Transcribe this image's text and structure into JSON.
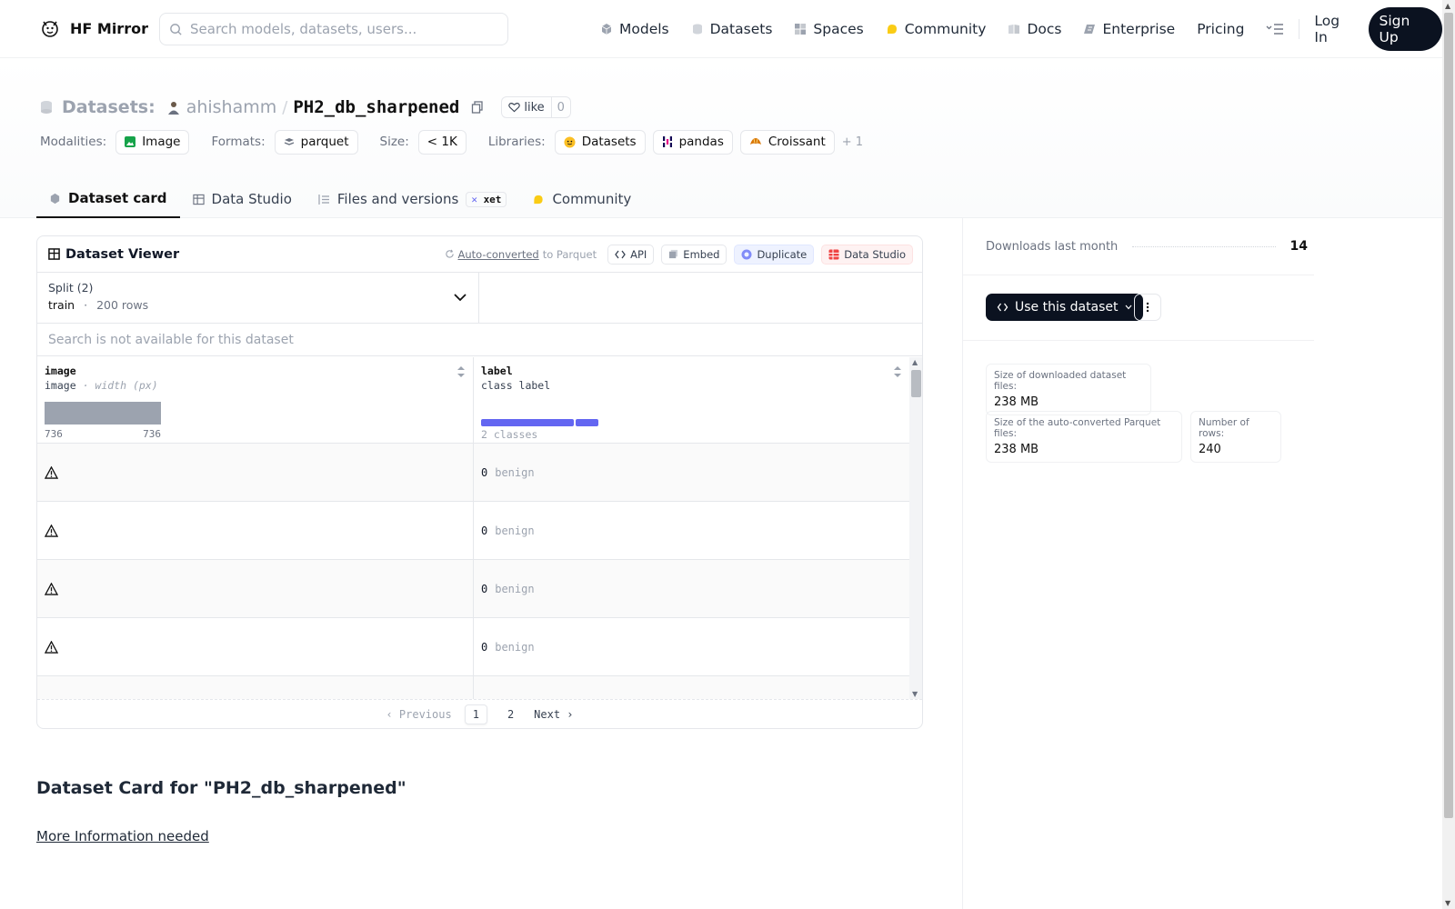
{
  "nav": {
    "brand": "HF Mirror",
    "search_placeholder": "Search models, datasets, users...",
    "items": [
      {
        "label": "Models",
        "icon": "models-icon",
        "color": "#9ca3af"
      },
      {
        "label": "Datasets",
        "icon": "datasets-icon",
        "color": "#d1d5db"
      },
      {
        "label": "Spaces",
        "icon": "spaces-icon",
        "color": "#9ca3af"
      },
      {
        "label": "Community",
        "icon": "community-icon",
        "color": "#facc15"
      },
      {
        "label": "Docs",
        "icon": "docs-icon",
        "color": "#d1d5db"
      },
      {
        "label": "Enterprise",
        "icon": "enterprise-icon",
        "color": "#9ca3af"
      },
      {
        "label": "Pricing",
        "icon": "",
        "color": ""
      }
    ],
    "login": "Log In",
    "signup": "Sign Up"
  },
  "header": {
    "section": "Datasets:",
    "owner": "ahishamm",
    "separator": "/",
    "repo": "PH2_db_sharpened",
    "like_label": "like",
    "like_count": "0",
    "meta": {
      "modalities_key": "Modalities:",
      "modalities": "Image",
      "formats_key": "Formats:",
      "formats": "parquet",
      "size_key": "Size:",
      "size": "< 1K",
      "libraries_key": "Libraries:",
      "libraries": [
        "Datasets",
        "pandas",
        "Croissant"
      ],
      "more": "+ 1"
    },
    "tabs": [
      "Dataset card",
      "Data Studio",
      "Files and versions",
      "Community"
    ],
    "xet_badge": "xet"
  },
  "viewer": {
    "title": "Dataset Viewer",
    "auto_converted": "Auto-converted",
    "to_parquet": "to Parquet",
    "buttons": {
      "api": "API",
      "embed": "Embed",
      "duplicate": "Duplicate",
      "studio": "Data Studio"
    },
    "split_label": "Split (2)",
    "split_value": "train",
    "split_dot": "·",
    "split_rows": "200 rows",
    "search_na": "Search is not available for this dataset",
    "columns": [
      {
        "name": "image",
        "type": "image",
        "subtype": "· width (px)",
        "min": "736",
        "max": "736"
      },
      {
        "name": "label",
        "type": "class label",
        "classes": "2 classes",
        "class_fractions": [
          0.8,
          0.2
        ]
      }
    ],
    "rows": [
      {
        "label_id": "0",
        "label_name": "benign"
      },
      {
        "label_id": "0",
        "label_name": "benign"
      },
      {
        "label_id": "0",
        "label_name": "benign"
      },
      {
        "label_id": "0",
        "label_name": "benign"
      }
    ],
    "pager": {
      "prev": "Previous",
      "pages": [
        "1",
        "2"
      ],
      "current": "1",
      "next": "Next"
    }
  },
  "card": {
    "title": "Dataset Card for \"PH2_db_sharpened\"",
    "more_info": "More Information needed"
  },
  "sidebar": {
    "downloads_label": "Downloads last month",
    "downloads_value": "14",
    "use_button": "Use this dataset",
    "stats": [
      {
        "key": "Size of downloaded dataset files:",
        "value": "238 MB"
      },
      {
        "key": "Size of the auto-converted Parquet files:",
        "value": "238 MB"
      },
      {
        "key": "Number of rows:",
        "value": "240"
      }
    ]
  }
}
